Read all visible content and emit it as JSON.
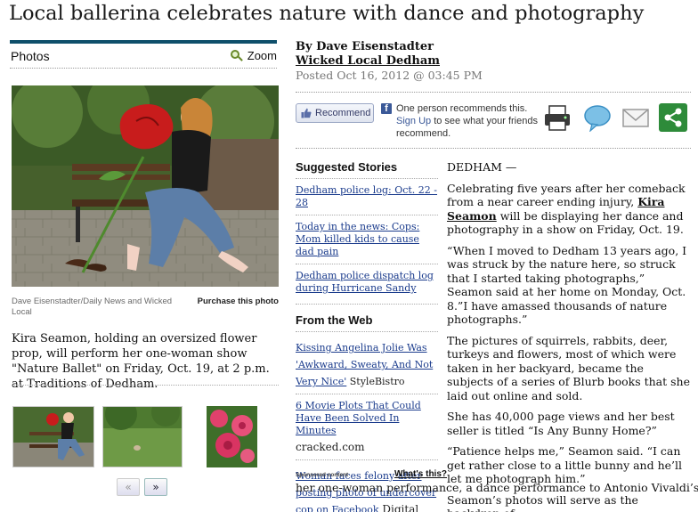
{
  "headline": "Local ballerina celebrates nature with dance and photography",
  "photos": {
    "title": "Photos",
    "zoom_label": "Zoom",
    "credit": "Dave Eisenstadter/Daily News and Wicked Local",
    "purchase": "Purchase this photo",
    "caption": "Kira Seamon, holding an oversized flower prop, will perform her one-woman show \"Nature Ballet\" on Friday, Oct. 19, at 2 p.m. at Traditions of Dedham.",
    "prev": "«",
    "next": "»"
  },
  "byline": {
    "author": "By Dave Eisenstadter",
    "publication": "Wicked Local Dedham",
    "posted": "Posted Oct 16, 2012 @ 03:45 PM"
  },
  "recommend": {
    "button_label": "Recommend",
    "text_before": "One person recommends this.",
    "signup": "Sign Up",
    "text_after": " to see what your friends recommend."
  },
  "share": {
    "icons": [
      "print-icon",
      "comment-icon",
      "email-icon",
      "share-icon"
    ]
  },
  "suggested": {
    "title": "Suggested Stories",
    "items": [
      "Dedham police log: Oct. 22 - 28",
      "Today in the news: Cops: Mom killed kids to cause dad pain",
      "Dedham police dispatch log during Hurricane Sandy"
    ]
  },
  "web": {
    "title": "From the Web",
    "items": [
      {
        "link": "Kissing Angelina Jolie Was 'Awkward, Sweaty, And Not Very Nice'",
        "source": " StyleBistro"
      },
      {
        "link": "6 Movie Plots That Could Have Been Solved In Minutes",
        "source": "cracked.com"
      },
      {
        "link": "Woman faces felony after posting photo of undercover cop on Facebook",
        "source": " Digital Trends"
      }
    ],
    "sponsored": "Sponsored content",
    "whats_this": "What's this?"
  },
  "article": {
    "dateline": "DEDHAM —",
    "p1_before": "Celebrating five years after her comeback from a near career ending injury, ",
    "p1_name": "Kira Seamon",
    "p1_after": " will be displaying her dance and photography in a show on Friday, Oct. 19.",
    "p2": "“When I moved to Dedham 13 years ago, I was struck by the nature here, so struck that I started taking photographs,” Seamon said at her home on Monday, Oct. 8.”I have amassed thousands of nature photographs.”",
    "p3": "The pictures of squirrels, rabbits, deer, turkeys and flowers, most of which were taken in her backyard, became the subjects of a series of Blurb books that she laid out online and sold.",
    "p4": "She has 40,000 page views and her best seller is titled “Is Any Bunny Home?”",
    "p5": "“Patience helps me,” Seamon said. “I can get rather close to a little bunny and he’ll let me photograph him.”",
    "p6_start": "Seamon’s photos will serve as the backdrop of",
    "p6_cont": "her one-woman performance, a dance performance to Antonio Vivaldi’s “The"
  }
}
